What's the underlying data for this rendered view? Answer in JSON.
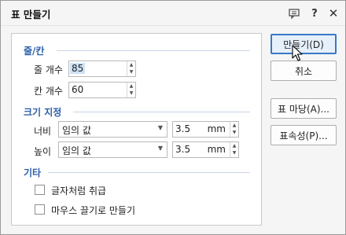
{
  "title": "표 만들기",
  "titlebar": {
    "help_label": "?",
    "close_label": "✕",
    "chat_icon": "chat-icon"
  },
  "rows_cols": {
    "title": "줄/칸",
    "rows_label": "줄 개수",
    "rows_value": "85",
    "cols_label": "칸 개수",
    "cols_value": "60"
  },
  "size": {
    "title": "크기 지정",
    "width_label": "너비",
    "width_mode": "임의 값",
    "width_value": "3.5",
    "width_unit": "mm",
    "height_label": "높이",
    "height_mode": "임의 값",
    "height_value": "3.5",
    "height_unit": "mm"
  },
  "etc": {
    "title": "기타",
    "treat_as_char": "글자처럼 취급",
    "drag_create": "마우스 끌기로 만들기"
  },
  "buttons": {
    "create": "만들기(D)",
    "cancel": "취소",
    "table_tray": "표 마당(A)...",
    "table_props": "표속성(P)..."
  }
}
